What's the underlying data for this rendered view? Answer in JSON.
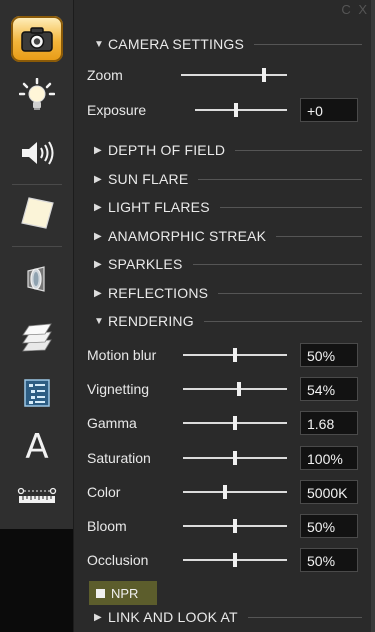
{
  "toolbar": {
    "items": [
      {
        "name": "camera-icon",
        "active": true
      },
      {
        "name": "lightbulb-icon",
        "active": false
      },
      {
        "name": "speaker-icon",
        "active": false
      },
      {
        "name": "paper-icon",
        "active": false
      },
      {
        "name": "lens-icon",
        "active": false
      },
      {
        "name": "layers-icon",
        "active": false
      },
      {
        "name": "list-icon",
        "active": false
      },
      {
        "name": "text-icon",
        "active": false
      },
      {
        "name": "ruler-icon",
        "active": false
      }
    ],
    "text_icon_glyph": "A",
    "active_color": "#f3b53b"
  },
  "panel": {
    "corner": "C X",
    "camera_settings": {
      "label": "CAMERA SETTINGS",
      "zoom": {
        "label": "Zoom",
        "level": 0.78
      },
      "exposure": {
        "label": "Exposure",
        "level": 0.45,
        "value": "+0"
      }
    },
    "collapsed_sections": [
      "DEPTH OF FIELD",
      "SUN FLARE",
      "LIGHT FLARES",
      "ANAMORPHIC STREAK",
      "SPARKLES",
      "REFLECTIONS"
    ],
    "rendering": {
      "label": "RENDERING",
      "rows": [
        {
          "label": "Motion blur",
          "level": 0.5,
          "value": "50%"
        },
        {
          "label": "Vignetting",
          "level": 0.54,
          "value": "54%"
        },
        {
          "label": "Gamma",
          "level": 0.5,
          "value": "1.68"
        },
        {
          "label": "Saturation",
          "level": 0.5,
          "value": "100%"
        },
        {
          "label": "Color",
          "level": 0.4,
          "value": "5000K"
        },
        {
          "label": "Bloom",
          "level": 0.5,
          "value": "50%"
        },
        {
          "label": "Occlusion",
          "level": 0.5,
          "value": "50%"
        }
      ],
      "npr_label": "NPR"
    },
    "link_and_look_at": "LINK AND LOOK AT"
  }
}
